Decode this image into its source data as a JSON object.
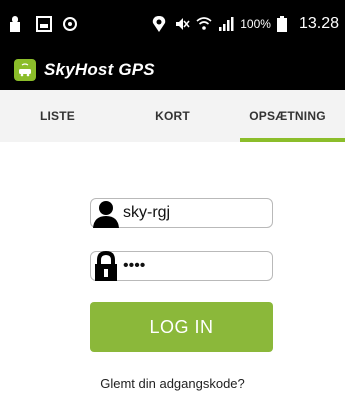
{
  "status_bar": {
    "battery_percent": "100%",
    "time": "13.28",
    "icons": [
      "lock-icon",
      "image-icon",
      "sync-icon",
      "location-icon",
      "mute-icon",
      "wifi-icon",
      "signal-icon",
      "battery-icon"
    ]
  },
  "app": {
    "title": "SkyHost GPS",
    "accent_color": "#8bbd2a"
  },
  "tabs": [
    {
      "label": "LISTE",
      "active": false
    },
    {
      "label": "KORT",
      "active": false
    },
    {
      "label": "OPSÆTNING",
      "active": true
    }
  ],
  "login": {
    "username_value": "sky-rgj",
    "password_value": "••••",
    "button_label": "LOG IN",
    "forgot_link": "Glemt din adgangskode?"
  }
}
